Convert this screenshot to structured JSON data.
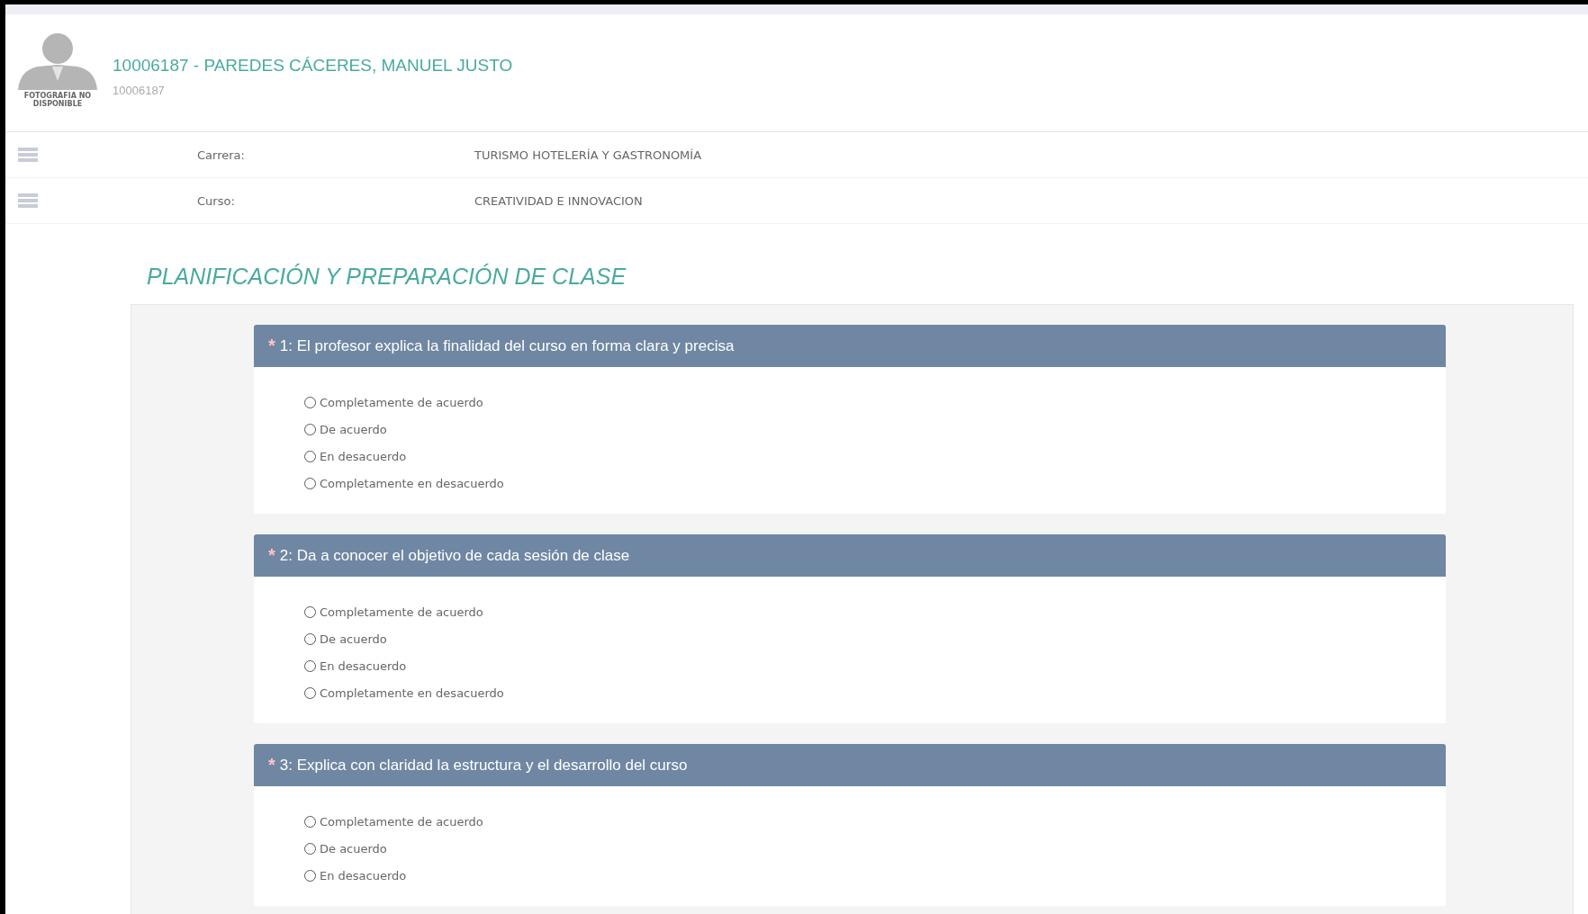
{
  "profile": {
    "title": "10006187 - PAREDES CÁCERES, MANUEL JUSTO",
    "subtitle": "10006187",
    "photo_caption": "FOTOGRAFIA NO DISPONIBLE"
  },
  "info_rows": [
    {
      "label": "Carrera:",
      "value": "TURISMO HOTELERÍA Y GASTRONOMÍA"
    },
    {
      "label": "Curso:",
      "value": "CREATIVIDAD E INNOVACION"
    }
  ],
  "section_title": "PLANIFICACIÓN Y PREPARACIÓN DE CLASE",
  "questions": [
    {
      "required_mark": "*",
      "text": "1: El profesor explica la finalidad del curso en forma clara y precisa",
      "options": [
        {
          "label": "Completamente de acuerdo",
          "selected": false
        },
        {
          "label": "De acuerdo",
          "selected": false
        },
        {
          "label": "En desacuerdo",
          "selected": false
        },
        {
          "label": "Completamente en desacuerdo",
          "selected": false
        }
      ]
    },
    {
      "required_mark": "*",
      "text": "2: Da a conocer el objetivo de cada sesión de clase",
      "options": [
        {
          "label": "Completamente de acuerdo",
          "selected": false
        },
        {
          "label": "De acuerdo",
          "selected": false
        },
        {
          "label": "En desacuerdo",
          "selected": false
        },
        {
          "label": "Completamente en desacuerdo",
          "selected": false
        }
      ]
    },
    {
      "required_mark": "*",
      "text": "3: Explica con claridad la estructura y el desarrollo del curso",
      "options": [
        {
          "label": "Completamente de acuerdo",
          "selected": false
        },
        {
          "label": "De acuerdo",
          "selected": false
        },
        {
          "label": "En desacuerdo",
          "selected": false
        }
      ]
    }
  ]
}
